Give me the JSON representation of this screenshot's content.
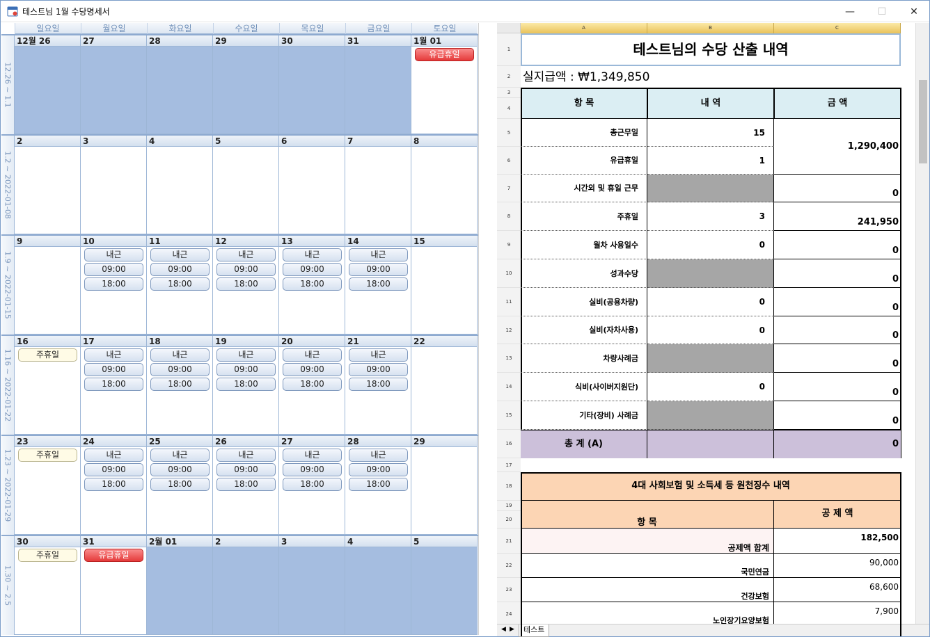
{
  "window": {
    "title": "테스트님 1월 수당명세서",
    "minimize": "—",
    "maximize": "☐",
    "close": "✕"
  },
  "calendar": {
    "daynames": [
      "일요일",
      "월요일",
      "화요일",
      "수요일",
      "목요일",
      "금요일",
      "토요일"
    ],
    "weeks": [
      {
        "label": "12.26 ~ 1.1",
        "days": [
          {
            "num": "12월 26",
            "gray": true,
            "items": []
          },
          {
            "num": "27",
            "gray": true,
            "items": []
          },
          {
            "num": "28",
            "gray": true,
            "items": []
          },
          {
            "num": "29",
            "gray": true,
            "items": []
          },
          {
            "num": "30",
            "gray": true,
            "items": []
          },
          {
            "num": "31",
            "gray": true,
            "items": []
          },
          {
            "num": "1월 01",
            "gray": false,
            "items": [
              {
                "text": "유급휴일",
                "kind": "red"
              }
            ]
          }
        ]
      },
      {
        "label": "1.2 ~ 2022-01-08",
        "days": [
          {
            "num": "2",
            "gray": false,
            "items": []
          },
          {
            "num": "3",
            "gray": false,
            "items": []
          },
          {
            "num": "4",
            "gray": false,
            "items": []
          },
          {
            "num": "5",
            "gray": false,
            "items": []
          },
          {
            "num": "6",
            "gray": false,
            "items": []
          },
          {
            "num": "7",
            "gray": false,
            "items": []
          },
          {
            "num": "8",
            "gray": false,
            "items": []
          }
        ]
      },
      {
        "label": "1.9 ~ 2022-01-15",
        "days": [
          {
            "num": "9",
            "gray": false,
            "items": []
          },
          {
            "num": "10",
            "gray": false,
            "items": [
              {
                "text": "내근",
                "kind": "blue"
              },
              {
                "text": "09:00",
                "kind": "blue"
              },
              {
                "text": "18:00",
                "kind": "blue"
              }
            ]
          },
          {
            "num": "11",
            "gray": false,
            "items": [
              {
                "text": "내근",
                "kind": "blue"
              },
              {
                "text": "09:00",
                "kind": "blue"
              },
              {
                "text": "18:00",
                "kind": "blue"
              }
            ]
          },
          {
            "num": "12",
            "gray": false,
            "items": [
              {
                "text": "내근",
                "kind": "blue"
              },
              {
                "text": "09:00",
                "kind": "blue"
              },
              {
                "text": "18:00",
                "kind": "blue"
              }
            ]
          },
          {
            "num": "13",
            "gray": false,
            "items": [
              {
                "text": "내근",
                "kind": "blue"
              },
              {
                "text": "09:00",
                "kind": "blue"
              },
              {
                "text": "18:00",
                "kind": "blue"
              }
            ]
          },
          {
            "num": "14",
            "gray": false,
            "items": [
              {
                "text": "내근",
                "kind": "blue"
              },
              {
                "text": "09:00",
                "kind": "blue"
              },
              {
                "text": "18:00",
                "kind": "blue"
              }
            ]
          },
          {
            "num": "15",
            "gray": false,
            "items": []
          }
        ]
      },
      {
        "label": "1.16 ~ 2022-01-22",
        "days": [
          {
            "num": "16",
            "gray": false,
            "items": [
              {
                "text": "주휴일",
                "kind": "yellow"
              }
            ]
          },
          {
            "num": "17",
            "gray": false,
            "items": [
              {
                "text": "내근",
                "kind": "blue"
              },
              {
                "text": "09:00",
                "kind": "blue"
              },
              {
                "text": "18:00",
                "kind": "blue"
              }
            ]
          },
          {
            "num": "18",
            "gray": false,
            "items": [
              {
                "text": "내근",
                "kind": "blue"
              },
              {
                "text": "09:00",
                "kind": "blue"
              },
              {
                "text": "18:00",
                "kind": "blue"
              }
            ]
          },
          {
            "num": "19",
            "gray": false,
            "items": [
              {
                "text": "내근",
                "kind": "blue"
              },
              {
                "text": "09:00",
                "kind": "blue"
              },
              {
                "text": "18:00",
                "kind": "blue"
              }
            ]
          },
          {
            "num": "20",
            "gray": false,
            "items": [
              {
                "text": "내근",
                "kind": "blue"
              },
              {
                "text": "09:00",
                "kind": "blue"
              },
              {
                "text": "18:00",
                "kind": "blue"
              }
            ]
          },
          {
            "num": "21",
            "gray": false,
            "items": [
              {
                "text": "내근",
                "kind": "blue"
              },
              {
                "text": "09:00",
                "kind": "blue"
              },
              {
                "text": "18:00",
                "kind": "blue"
              }
            ]
          },
          {
            "num": "22",
            "gray": false,
            "items": []
          }
        ]
      },
      {
        "label": "1.23 ~ 2022-01-29",
        "days": [
          {
            "num": "23",
            "gray": false,
            "items": [
              {
                "text": "주휴일",
                "kind": "yellow"
              }
            ]
          },
          {
            "num": "24",
            "gray": false,
            "items": [
              {
                "text": "내근",
                "kind": "blue"
              },
              {
                "text": "09:00",
                "kind": "blue"
              },
              {
                "text": "18:00",
                "kind": "blue"
              }
            ]
          },
          {
            "num": "25",
            "gray": false,
            "items": [
              {
                "text": "내근",
                "kind": "blue"
              },
              {
                "text": "09:00",
                "kind": "blue"
              },
              {
                "text": "18:00",
                "kind": "blue"
              }
            ]
          },
          {
            "num": "26",
            "gray": false,
            "items": [
              {
                "text": "내근",
                "kind": "blue"
              },
              {
                "text": "09:00",
                "kind": "blue"
              },
              {
                "text": "18:00",
                "kind": "blue"
              }
            ]
          },
          {
            "num": "27",
            "gray": false,
            "items": [
              {
                "text": "내근",
                "kind": "blue"
              },
              {
                "text": "09:00",
                "kind": "blue"
              },
              {
                "text": "18:00",
                "kind": "blue"
              }
            ]
          },
          {
            "num": "28",
            "gray": false,
            "items": [
              {
                "text": "내근",
                "kind": "blue"
              },
              {
                "text": "09:00",
                "kind": "blue"
              },
              {
                "text": "18:00",
                "kind": "blue"
              }
            ]
          },
          {
            "num": "29",
            "gray": false,
            "items": []
          }
        ]
      },
      {
        "label": "1.30 ~ 2.5",
        "days": [
          {
            "num": "30",
            "gray": false,
            "items": [
              {
                "text": "주휴일",
                "kind": "yellow"
              }
            ]
          },
          {
            "num": "31",
            "gray": false,
            "items": [
              {
                "text": "유급휴일",
                "kind": "red"
              }
            ]
          },
          {
            "num": "2월 01",
            "gray": true,
            "items": []
          },
          {
            "num": "2",
            "gray": true,
            "items": []
          },
          {
            "num": "3",
            "gray": true,
            "items": []
          },
          {
            "num": "4",
            "gray": true,
            "items": []
          },
          {
            "num": "5",
            "gray": true,
            "items": []
          }
        ]
      }
    ]
  },
  "sheet": {
    "columns": [
      "A",
      "B",
      "C"
    ],
    "title": "테스트님의 수당 산출 내역",
    "net_pay": "실지급액 : ₩1,349,850",
    "headers": {
      "item": "항 목",
      "detail": "내 역",
      "amount": "금 액"
    },
    "rows": [
      {
        "row": "5",
        "label": "총근무일",
        "detail": "15",
        "amount": ""
      },
      {
        "row": "6",
        "label": "유급휴일",
        "detail": "1",
        "amount": ""
      },
      {
        "row": "7",
        "label": "시간외 및 휴일 근무",
        "detail": "",
        "amount": "0",
        "grayDetail": true
      },
      {
        "row": "8",
        "label": "주휴일",
        "detail": "3",
        "amount": "241,950"
      },
      {
        "row": "9",
        "label": "월차 사용일수",
        "detail": "0",
        "amount": "0"
      },
      {
        "row": "10",
        "label": "성과수당",
        "detail": "",
        "amount": "0",
        "grayDetail": true
      },
      {
        "row": "11",
        "label": "실비(공용차량)",
        "detail": "0",
        "amount": "0"
      },
      {
        "row": "12",
        "label": "실비(자차사용)",
        "detail": "0",
        "amount": "0"
      },
      {
        "row": "13",
        "label": "차량사례금",
        "detail": "",
        "amount": "0",
        "grayDetail": true
      },
      {
        "row": "14",
        "label": "식비(사이버지원단)",
        "detail": "0",
        "amount": "0"
      },
      {
        "row": "15",
        "label": "기타(장비) 사례금",
        "detail": "",
        "amount": "0",
        "grayDetail": true
      }
    ],
    "merged_amount_5_6": "1,290,400",
    "total": {
      "label": "총    계    (A)",
      "amount": "0"
    },
    "deduction": {
      "title": "4대 사회보험 및 소득세 등 원천징수 내역",
      "item_header": "항 목",
      "amount_header": "공 제 액",
      "rows": [
        {
          "row": "21",
          "label": "공제액 합계",
          "amount": "182,500"
        },
        {
          "row": "22",
          "label": "국민연금",
          "amount": "90,000"
        },
        {
          "row": "23",
          "label": "건강보험",
          "amount": "68,600"
        },
        {
          "row": "24",
          "label": "노인장기요양보험",
          "amount": "7,900"
        }
      ]
    },
    "row_numbers": [
      "1",
      "2",
      "3",
      "4",
      "5",
      "6",
      "7",
      "8",
      "9",
      "10",
      "11",
      "12",
      "13",
      "14",
      "15",
      "16",
      "17",
      "18",
      "19",
      "20",
      "21",
      "22",
      "23",
      "24"
    ],
    "tab_name": "테스트",
    "colors": {
      "header_fill": "#dbeef3",
      "total_fill": "#ccc0da",
      "deduction_fill": "#fcd5b4",
      "gray_fill": "#a6a6a6"
    }
  }
}
